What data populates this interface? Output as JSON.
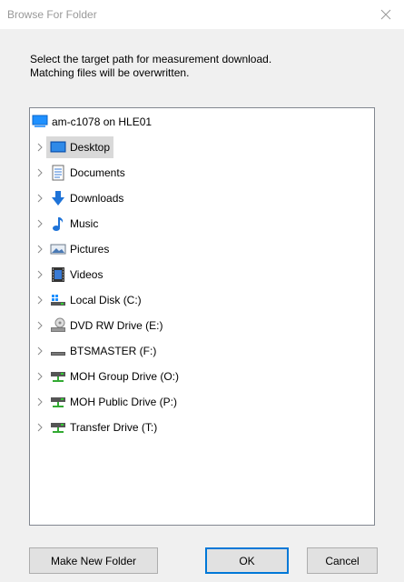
{
  "window": {
    "title": "Browse For Folder",
    "close_icon": "close-icon"
  },
  "instructions": {
    "line1": "Select the target path for measurement download.",
    "line2": "Matching files will be overwritten."
  },
  "tree": {
    "root": {
      "label": "am-c1078 on HLE01",
      "icon": "computer-icon"
    },
    "items": [
      {
        "label": "Desktop",
        "icon": "desktop-icon",
        "selected": true
      },
      {
        "label": "Documents",
        "icon": "documents-icon"
      },
      {
        "label": "Downloads",
        "icon": "downloads-icon"
      },
      {
        "label": "Music",
        "icon": "music-icon"
      },
      {
        "label": "Pictures",
        "icon": "pictures-icon"
      },
      {
        "label": "Videos",
        "icon": "videos-icon"
      },
      {
        "label": "Local Disk (C:)",
        "icon": "local-disk-icon"
      },
      {
        "label": "DVD RW Drive (E:)",
        "icon": "dvd-drive-icon"
      },
      {
        "label": "BTSMASTER (F:)",
        "icon": "removable-drive-icon"
      },
      {
        "label": "MOH Group Drive (O:)",
        "icon": "network-drive-icon"
      },
      {
        "label": "MOH Public Drive (P:)",
        "icon": "network-drive-icon"
      },
      {
        "label": "Transfer Drive (T:)",
        "icon": "network-drive-icon"
      }
    ]
  },
  "buttons": {
    "make_new_folder": "Make New Folder",
    "ok": "OK",
    "cancel": "Cancel"
  },
  "colors": {
    "selection": "#d9d9d9",
    "accent": "#0078d7",
    "dialog_bg": "#f0f0f0"
  }
}
